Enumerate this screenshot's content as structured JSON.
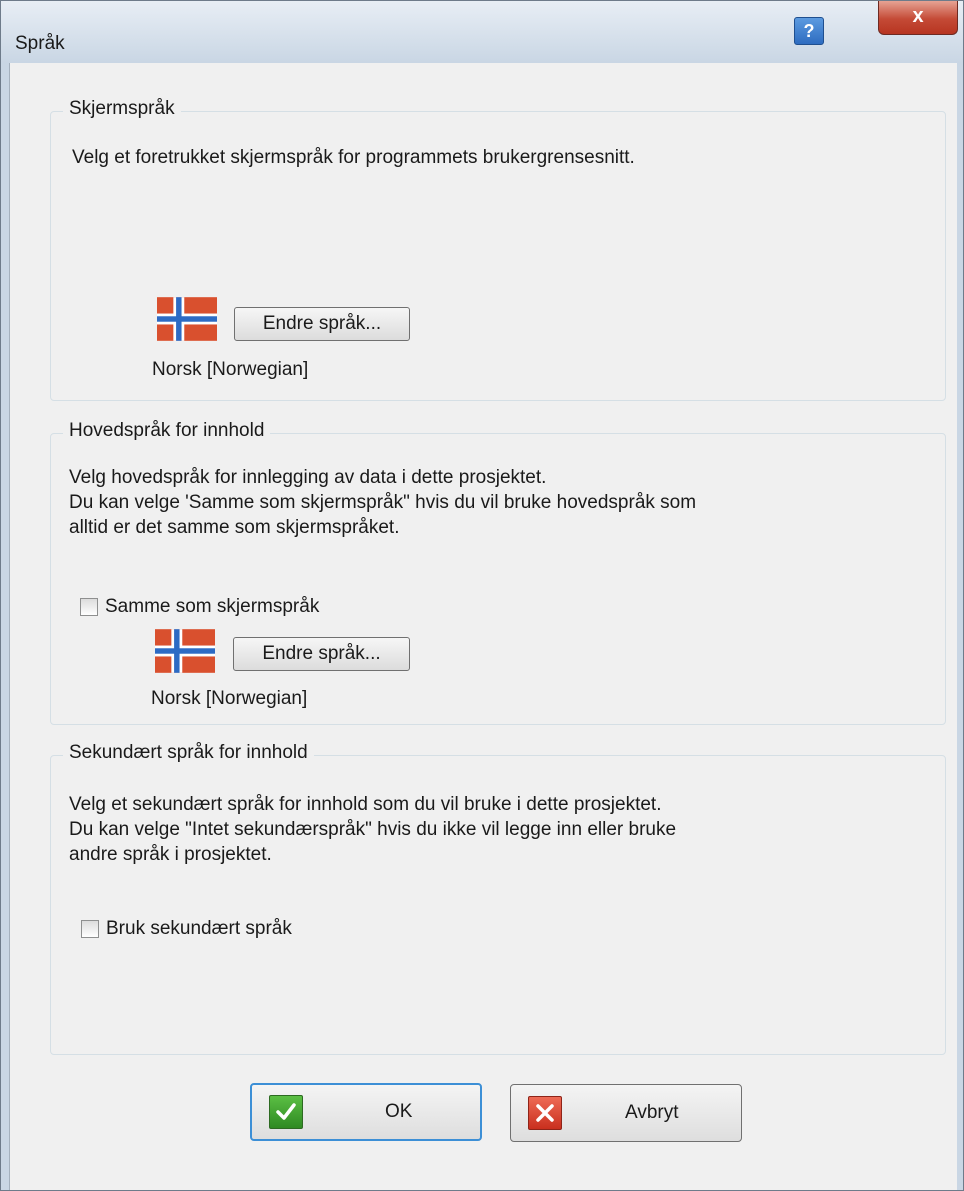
{
  "window": {
    "title": "Språk",
    "help_label": "?",
    "close_label": "x"
  },
  "display_language": {
    "group_title": "Skjermspråk",
    "description": "Velg et foretrukket skjermspråk for programmets brukergrensesnitt.",
    "change_button": "Endre språk...",
    "language_name": "Norsk [Norwegian]"
  },
  "content_language": {
    "group_title": "Hovedspråk for innhold",
    "description_lines": [
      "Velg hovedspråk for innlegging av data i dette prosjektet.",
      "Du kan velge 'Samme som skjermspråk\" hvis du vil bruke hovedspråk som",
      "alltid er det samme som skjermspråket."
    ],
    "same_as_display_label": "Samme som skjermspråk",
    "same_as_display_checked": false,
    "change_button": "Endre språk...",
    "language_name": "Norsk [Norwegian]"
  },
  "secondary_language": {
    "group_title": "Sekundært språk for innhold",
    "description_lines": [
      "Velg et sekundært språk for innhold som du vil bruke i dette prosjektet.",
      "Du kan velge \"Intet sekundærspråk\" hvis du ikke vil legge inn eller bruke",
      "andre språk i prosjektet."
    ],
    "use_secondary_label": "Bruk sekundært språk",
    "use_secondary_checked": false
  },
  "footer": {
    "ok_label": "OK",
    "cancel_label": "Avbryt"
  },
  "colors": {
    "flag_red": "#d9502e",
    "flag_blue": "#2d6bc4",
    "ok_border": "#3c8fd6",
    "ok_icon": "#3a9a2a",
    "cancel_icon": "#d33b2a"
  }
}
